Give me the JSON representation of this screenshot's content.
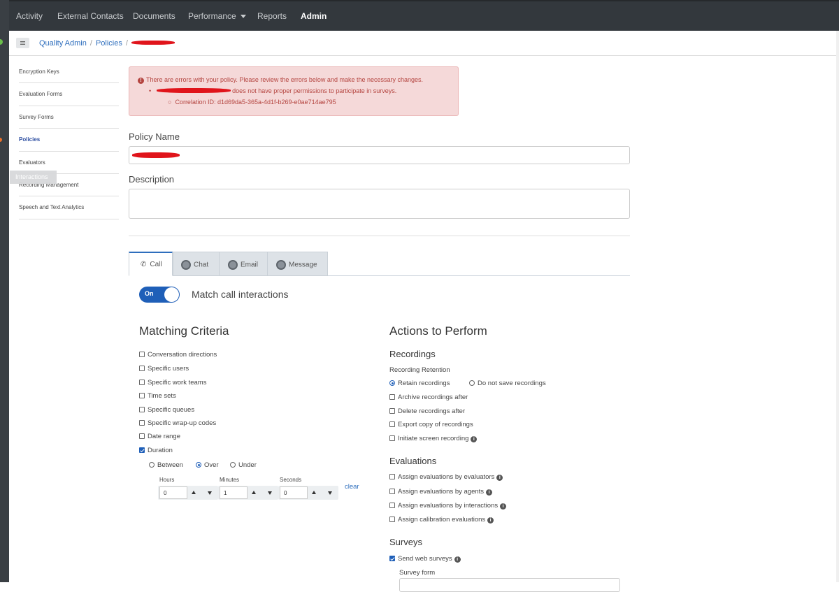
{
  "topnav": {
    "items": [
      "Activity",
      "External Contacts",
      "Documents",
      "Performance",
      "Reports",
      "Admin"
    ]
  },
  "breadcrumb": {
    "items": [
      "Quality Admin",
      "Policies"
    ]
  },
  "sidebar": {
    "items": [
      "Encryption Keys",
      "Evaluation Forms",
      "Survey Forms",
      "Policies",
      "Evaluators",
      "Recording Management",
      "Speech and Text Analytics"
    ],
    "tooltip": "Interactions"
  },
  "alert": {
    "line1": "There are errors with your policy. Please review the errors below and make the necessary changes.",
    "line2": "does not have proper permissions to participate in surveys.",
    "line3": "Correlation ID: d1d69da5-365a-4d1f-b269-e0ae714ae795"
  },
  "form": {
    "policy_name_label": "Policy Name",
    "description_label": "Description"
  },
  "tabs": [
    "Call",
    "Chat",
    "Email",
    "Message"
  ],
  "toggle": {
    "state": "On",
    "label": "Match call interactions"
  },
  "criteria": {
    "title": "Matching Criteria",
    "items": [
      "Conversation directions",
      "Specific users",
      "Specific work teams",
      "Time sets",
      "Specific queues",
      "Specific wrap-up codes",
      "Date range",
      "Duration"
    ],
    "duration_options": [
      "Between",
      "Over",
      "Under"
    ],
    "hours_label": "Hours",
    "minutes_label": "Minutes",
    "seconds_label": "Seconds",
    "hours": "0",
    "minutes": "1",
    "seconds": "0",
    "clear": "clear"
  },
  "actions": {
    "title": "Actions to Perform",
    "recordings_title": "Recordings",
    "retention_label": "Recording Retention",
    "retain": "Retain recordings",
    "do_not_save": "Do not save recordings",
    "archive": "Archive recordings after",
    "delete": "Delete recordings after",
    "export": "Export copy of recordings",
    "screen": "Initiate screen recording",
    "evaluations_title": "Evaluations",
    "eval_items": [
      "Assign evaluations by evaluators",
      "Assign evaluations by agents",
      "Assign evaluations by interactions",
      "Assign calibration evaluations"
    ],
    "surveys_title": "Surveys",
    "send_surveys": "Send web surveys",
    "survey_form": "Survey form"
  }
}
